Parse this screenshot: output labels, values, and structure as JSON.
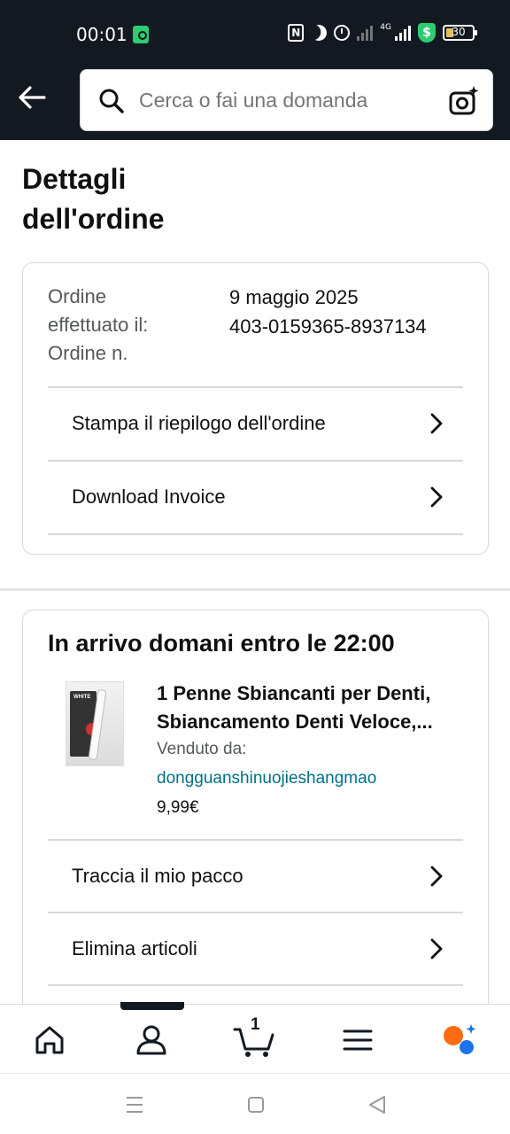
{
  "status_bar": {
    "time": "00:01",
    "network_label": "4G",
    "battery": "30"
  },
  "search": {
    "placeholder": "Cerca o fai una domanda"
  },
  "page": {
    "title": "Dettagli dell'ordine"
  },
  "order_summary": {
    "labels": [
      "Ordine",
      "effettuato il:",
      "Ordine n."
    ],
    "date": "9 maggio 2025",
    "order_number": "403-0159365-8937134",
    "links": [
      "Stampa il riepilogo dell'ordine",
      "Download Invoice"
    ]
  },
  "shipment": {
    "heading": "In arrivo domani entro le 22:00",
    "product_title": "1 Penne Sbiancanti per Denti, Sbiancamento Denti Veloce,...",
    "sold_by_label": "Venduto da:",
    "seller": "dongguanshinuojieshangmao",
    "price": "9,99€",
    "product_image_text": "WHITE",
    "links": [
      "Traccia il mio pacco",
      "Elimina articoli"
    ]
  },
  "bottom_nav": {
    "items": [
      "home-icon",
      "account-icon",
      "cart-icon",
      "menu-icon",
      "rufus-icon"
    ],
    "cart_count": "1",
    "active_index": 1
  },
  "colors": {
    "header": "#131921",
    "link": "#007185",
    "secondary_text": "#565959",
    "divider": "#d5d9d9"
  }
}
